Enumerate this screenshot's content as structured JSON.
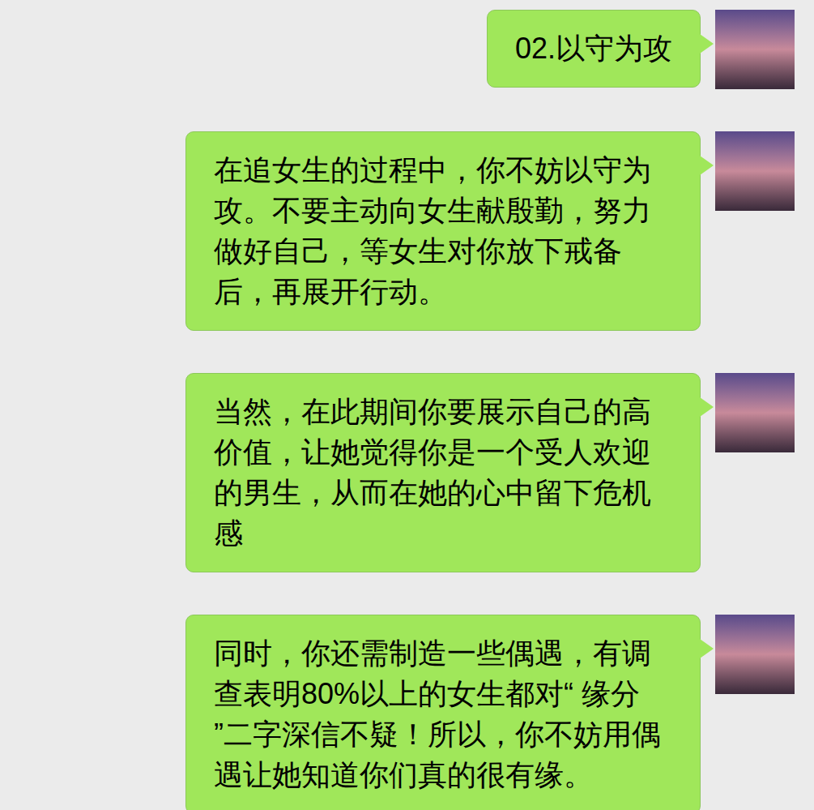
{
  "chat": {
    "messages": [
      {
        "text": "02.以守为攻",
        "side": "right"
      },
      {
        "text": "在追女生的过程中，你不妨以守为攻。不要主动向女生献殷勤，努力做好自己，等女生对你放下戒备后，再展开行动。",
        "side": "right"
      },
      {
        "text": "当然，在此期间你要展示自己的高价值，让她觉得你是一个受人欢迎的男生，从而在她的心中留下危机感",
        "side": "right"
      },
      {
        "text": "同时，你还需制造一些偶遇，有调查表明80%以上的女生都对“ 缘分 ”二字深信不疑！所以，你不妨用偶遇让她知道你们真的很有缘。",
        "side": "right"
      }
    ]
  }
}
